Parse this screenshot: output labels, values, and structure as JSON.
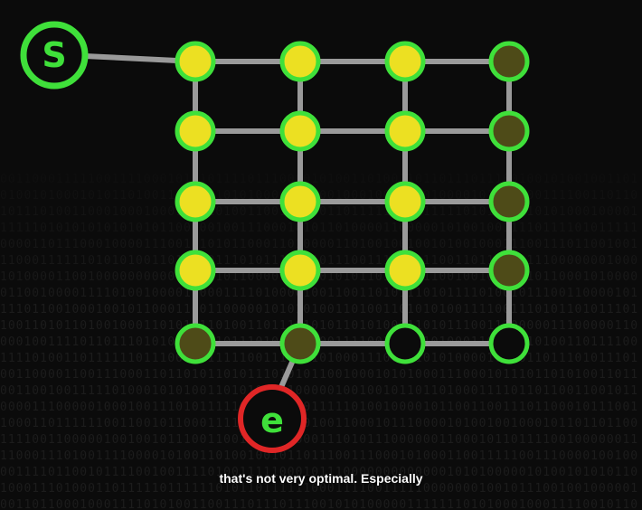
{
  "caption": "that's not very optimal. Especially",
  "start_node": {
    "label": "S",
    "color": "#3fe03a"
  },
  "end_node": {
    "label": "e",
    "color": "#e02626",
    "text_color": "#3fe03a"
  },
  "grid": {
    "columns": 4,
    "rows": 5,
    "states": [
      [
        "visited",
        "visited",
        "visited",
        "explored"
      ],
      [
        "visited",
        "visited",
        "visited",
        "explored"
      ],
      [
        "visited",
        "visited",
        "visited",
        "explored"
      ],
      [
        "visited",
        "visited",
        "visited",
        "explored"
      ],
      [
        "explored",
        "explored",
        "open",
        "open"
      ]
    ]
  },
  "colors": {
    "visited_fill": "#ece022",
    "explored_fill": "#4e4b18",
    "open_fill": "#0b0b0b",
    "ring": "#3fe03a",
    "edge": "#9a9a9a"
  }
}
